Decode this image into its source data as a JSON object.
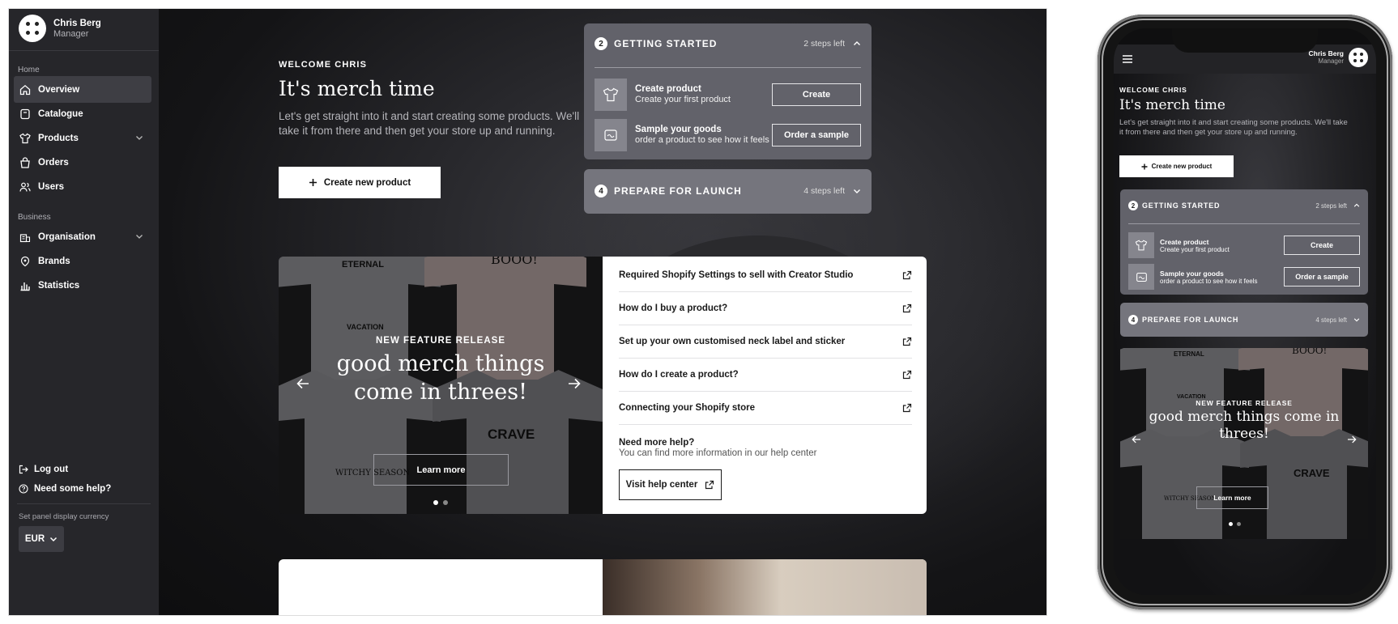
{
  "user": {
    "name": "Chris Berg",
    "role": "Manager"
  },
  "sidebar": {
    "home_label": "Home",
    "business_label": "Business",
    "items": [
      {
        "label": "Overview",
        "icon": "home-icon"
      },
      {
        "label": "Catalogue",
        "icon": "book-icon"
      },
      {
        "label": "Products",
        "icon": "shirt-icon"
      },
      {
        "label": "Orders",
        "icon": "bag-icon"
      },
      {
        "label": "Users",
        "icon": "users-icon"
      }
    ],
    "business_items": [
      {
        "label": "Organisation",
        "icon": "building-icon"
      },
      {
        "label": "Brands",
        "icon": "tag-icon"
      },
      {
        "label": "Statistics",
        "icon": "bar-chart-icon"
      }
    ],
    "logout": "Log out",
    "help": "Need some help?",
    "currency_label": "Set panel display currency",
    "currency_value": "EUR"
  },
  "welcome": {
    "kicker": "WELCOME CHRIS",
    "title": "It's merch time",
    "text": "Let's get straight into it and start creating some products. We'll take it from there and then get your store up and running.",
    "create_button": "Create new product"
  },
  "getting_started": {
    "number": "2",
    "title": "GETTING STARTED",
    "steps_left": "2 steps left",
    "steps": [
      {
        "title": "Create product",
        "subtitle": "Create your first product",
        "button": "Create",
        "icon": "shirt-icon"
      },
      {
        "title": "Sample your goods",
        "subtitle": "order a product to see how it feels",
        "button": "Order a sample",
        "icon": "sample-icon"
      }
    ]
  },
  "prepare_launch": {
    "number": "4",
    "title": "PREPARE FOR LAUNCH",
    "steps_left": "4 steps left"
  },
  "feature": {
    "kicker": "NEW FEATURE RELEASE",
    "title": "good merch things come in threes!",
    "learn_more": "Learn more",
    "shirt_texts": [
      "ETERNAL",
      "VACATION",
      "BOOO!",
      "WITCHY SEASON",
      "CRAVE"
    ]
  },
  "help_links": [
    "Required Shopify Settings to sell with Creator Studio",
    "How do I buy a product?",
    "Set up your own customised neck label and sticker",
    "How do I create a product?",
    "Connecting your Shopify store"
  ],
  "help": {
    "title": "Need more help?",
    "subtitle": "You can find more information in our help center",
    "button": "Visit help center"
  },
  "colors": {
    "sidebar": "#26262a",
    "card": "#62626a",
    "accent": "#ffffff"
  }
}
